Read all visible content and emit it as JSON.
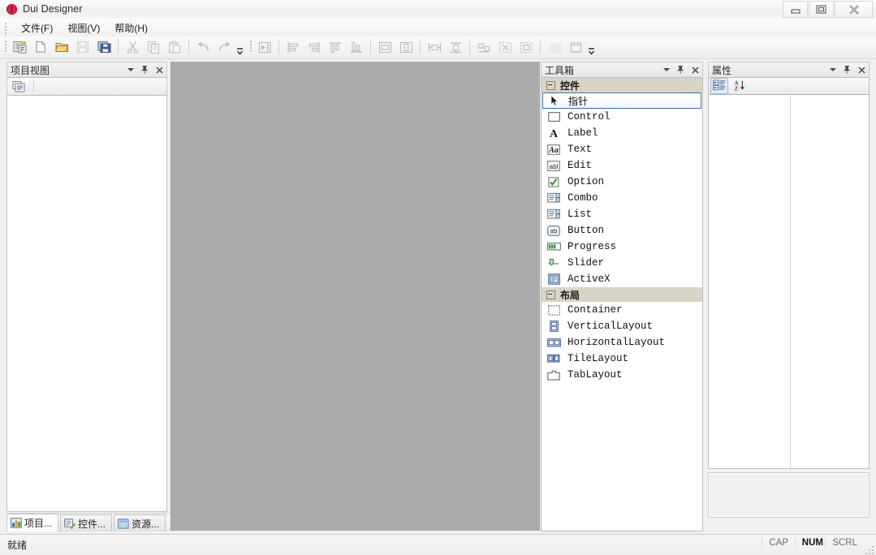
{
  "window": {
    "title": "Dui Designer",
    "app_icon": "dui-logo-icon",
    "minimize_label": "Minimize",
    "maximize_label": "Maximize",
    "close_label": "Close"
  },
  "menubar": {
    "items": [
      {
        "label": "文件(F)",
        "name": "menu-file"
      },
      {
        "label": "视图(V)",
        "name": "menu-view"
      },
      {
        "label": "帮助(H)",
        "name": "menu-help"
      }
    ]
  },
  "toolbar": {
    "groups": [
      {
        "buttons": [
          {
            "name": "new-project-button",
            "icon": "new-project-icon",
            "enabled": true
          },
          {
            "name": "new-file-button",
            "icon": "new-file-icon",
            "enabled": true
          },
          {
            "name": "open-button",
            "icon": "open-folder-icon",
            "enabled": true
          },
          {
            "name": "save-button",
            "icon": "save-icon",
            "enabled": false
          },
          {
            "name": "save-all-button",
            "icon": "save-all-icon",
            "enabled": true
          }
        ]
      },
      {
        "buttons": [
          {
            "name": "cut-button",
            "icon": "scissors-icon",
            "enabled": false
          },
          {
            "name": "copy-button",
            "icon": "copy-icon",
            "enabled": false
          },
          {
            "name": "paste-button",
            "icon": "paste-icon",
            "enabled": false
          }
        ]
      },
      {
        "buttons": [
          {
            "name": "undo-button",
            "icon": "undo-arrow-icon",
            "enabled": false
          },
          {
            "name": "redo-button",
            "icon": "redo-arrow-icon",
            "enabled": false
          }
        ]
      },
      {
        "buttons": [
          {
            "name": "run-preview-button",
            "icon": "run-preview-icon",
            "enabled": false
          }
        ]
      },
      {
        "buttons": [
          {
            "name": "align-left-button",
            "icon": "align-left-icon",
            "enabled": false
          },
          {
            "name": "align-right-button",
            "icon": "align-right-icon",
            "enabled": false
          },
          {
            "name": "align-top-button",
            "icon": "align-top-icon",
            "enabled": false
          },
          {
            "name": "align-bottom-button",
            "icon": "align-bottom-icon",
            "enabled": false
          }
        ]
      },
      {
        "buttons": [
          {
            "name": "center-horizontal-button",
            "icon": "center-horizontal-icon",
            "enabled": false
          },
          {
            "name": "center-vertical-button",
            "icon": "center-vertical-icon",
            "enabled": false
          }
        ]
      },
      {
        "buttons": [
          {
            "name": "same-width-button",
            "icon": "same-width-icon",
            "enabled": false
          },
          {
            "name": "same-height-button",
            "icon": "same-height-icon",
            "enabled": false
          }
        ]
      },
      {
        "buttons": [
          {
            "name": "space-horizontal-button",
            "icon": "space-horizontal-icon",
            "enabled": false
          },
          {
            "name": "break-layout-button",
            "icon": "break-layout-icon",
            "enabled": false
          },
          {
            "name": "adjust-size-button",
            "icon": "adjust-size-icon",
            "enabled": false
          }
        ]
      },
      {
        "buttons": [
          {
            "name": "toggle-grid-button",
            "icon": "grid-icon",
            "enabled": false
          },
          {
            "name": "form-frame-button",
            "icon": "form-frame-icon",
            "enabled": false
          }
        ]
      }
    ],
    "overflow_label": "More buttons"
  },
  "project_panel": {
    "title": "项目视图",
    "autohide_label": "Auto hide",
    "close_label": "Close",
    "menu_label": "Window position",
    "mini_toolbar": [
      {
        "name": "project-properties-button",
        "icon": "project-properties-icon"
      }
    ],
    "tree_items": []
  },
  "bottom_tabs": [
    {
      "label": "项目...",
      "name": "tab-project",
      "icon": "project-tab-icon",
      "active": true
    },
    {
      "label": "控件...",
      "name": "tab-controls",
      "icon": "controls-tab-icon",
      "active": false
    },
    {
      "label": "资源...",
      "name": "tab-resources",
      "icon": "resources-tab-icon",
      "active": false
    }
  ],
  "canvas": {
    "background_color": "#ababab",
    "name": "design-canvas"
  },
  "toolbox": {
    "title": "工具箱",
    "groups": [
      {
        "label": "控件",
        "name": "toolbox-group-controls",
        "expanded": true,
        "items": [
          {
            "label": "指针",
            "name": "toolbox-item-pointer",
            "icon": "pointer-cursor-icon",
            "selected": true,
            "cjk": true
          },
          {
            "label": "Control",
            "name": "toolbox-item-control",
            "icon": "control-box-icon",
            "selected": false
          },
          {
            "label": "Label",
            "name": "toolbox-item-label",
            "icon": "label-letter-a-icon",
            "selected": false
          },
          {
            "label": "Text",
            "name": "toolbox-item-text",
            "icon": "text-aa-icon",
            "selected": false
          },
          {
            "label": "Edit",
            "name": "toolbox-item-edit",
            "icon": "edit-abl-icon",
            "selected": false
          },
          {
            "label": "Option",
            "name": "toolbox-item-option",
            "icon": "checkbox-check-icon",
            "selected": false
          },
          {
            "label": "Combo",
            "name": "toolbox-item-combo",
            "icon": "combobox-icon",
            "selected": false
          },
          {
            "label": "List",
            "name": "toolbox-item-list",
            "icon": "listbox-icon",
            "selected": false
          },
          {
            "label": "Button",
            "name": "toolbox-item-button",
            "icon": "button-ab-icon",
            "selected": false
          },
          {
            "label": "Progress",
            "name": "toolbox-item-progress",
            "icon": "progressbar-icon",
            "selected": false
          },
          {
            "label": "Slider",
            "name": "toolbox-item-slider",
            "icon": "slider-icon",
            "selected": false
          },
          {
            "label": "ActiveX",
            "name": "toolbox-item-activex",
            "icon": "activex-icon",
            "selected": false
          }
        ]
      },
      {
        "label": "布局",
        "name": "toolbox-group-layout",
        "expanded": true,
        "items": [
          {
            "label": "Container",
            "name": "toolbox-item-container",
            "icon": "container-dashed-icon",
            "selected": false
          },
          {
            "label": "VerticalLayout",
            "name": "toolbox-item-verticallayout",
            "icon": "vertical-layout-icon",
            "selected": false
          },
          {
            "label": "HorizontalLayout",
            "name": "toolbox-item-horizontallayout",
            "icon": "horizontal-layout-icon",
            "selected": false
          },
          {
            "label": "TileLayout",
            "name": "toolbox-item-tilelayout",
            "icon": "tile-layout-icon",
            "selected": false
          },
          {
            "label": "TabLayout",
            "name": "toolbox-item-tablayout",
            "icon": "tab-layout-icon",
            "selected": false
          }
        ]
      }
    ]
  },
  "properties_panel": {
    "title": "属性",
    "toolbar": [
      {
        "name": "categorized-button",
        "icon": "categorized-view-icon",
        "active": true
      },
      {
        "name": "alphabetical-button",
        "icon": "alphabetical-sort-icon",
        "active": false
      }
    ],
    "rows": [],
    "description": ""
  },
  "statusbar": {
    "message": "就绪",
    "indicators": [
      {
        "label": "CAP",
        "name": "status-caps-lock",
        "on": false
      },
      {
        "label": "NUM",
        "name": "status-num-lock",
        "on": true
      },
      {
        "label": "SCRL",
        "name": "status-scroll-lock",
        "on": false
      }
    ]
  }
}
